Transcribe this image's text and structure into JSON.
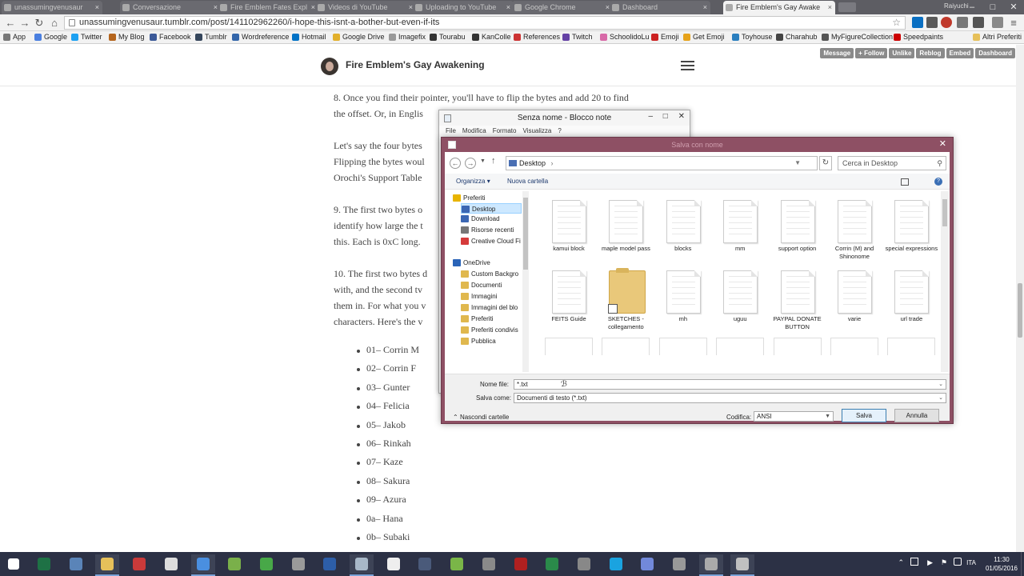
{
  "browser": {
    "tabs": [
      {
        "label": "unassumingvenusaur",
        "active": false
      },
      {
        "label": "Conversazione",
        "active": false
      },
      {
        "label": "Fire Emblem Fates Expl",
        "active": false
      },
      {
        "label": "Videos di YouTube",
        "active": false
      },
      {
        "label": "Uploading to YouTube",
        "active": false
      },
      {
        "label": "Google Chrome",
        "active": false
      },
      {
        "label": "Dashboard",
        "active": false
      },
      {
        "label": "Fire Emblem's Gay Awake",
        "active": true
      }
    ],
    "user_badge": "Raiyuchi",
    "url": "unassumingvenusaur.tumblr.com/post/141102962260/i-hope-this-isnt-a-bother-but-even-if-its",
    "bookmarks": [
      {
        "label": "App",
        "color": "#777777"
      },
      {
        "label": "Google",
        "color": "#4a7fe0"
      },
      {
        "label": "Twitter",
        "color": "#1da1f2"
      },
      {
        "label": "My Blog",
        "color": "#b5651d"
      },
      {
        "label": "Facebook",
        "color": "#3b5998"
      },
      {
        "label": "Tumblr",
        "color": "#35465c"
      },
      {
        "label": "Wordreference",
        "color": "#3366aa"
      },
      {
        "label": "Hotmail",
        "color": "#0072c6"
      },
      {
        "label": "Google Drive",
        "color": "#e2b02c"
      },
      {
        "label": "Imagefix",
        "color": "#999999"
      },
      {
        "label": "Tourabu",
        "color": "#333333"
      },
      {
        "label": "KanColle",
        "color": "#333333"
      },
      {
        "label": "References",
        "color": "#cc3333"
      },
      {
        "label": "Twitch",
        "color": "#6441a5"
      },
      {
        "label": "SchoolidoLu",
        "color": "#d86aa8"
      },
      {
        "label": "Emoji",
        "color": "#cc2222"
      },
      {
        "label": "Get Emoji",
        "color": "#e6a21a"
      },
      {
        "label": "Toyhouse",
        "color": "#2b7fbf"
      },
      {
        "label": "Charahub",
        "color": "#444444"
      },
      {
        "label": "MyFigureCollection",
        "color": "#555555"
      },
      {
        "label": "Speedpaints",
        "color": "#cc0000"
      }
    ],
    "other_bookmarks": "Altri Preferiti"
  },
  "tumblr_controls": [
    "Message",
    "+ Follow",
    "Unlike",
    "Reblog",
    "Embed",
    "Dashboard"
  ],
  "blog": {
    "title": "Fire Emblem's Gay Awakening",
    "paragraphs": [
      [
        "8. Once you find their pointer, you'll have to flip the bytes and add 20 to find",
        "the offset. Or, in Englis"
      ],
      [
        "Let's say the four bytes",
        "Flipping the bytes woul",
        "Orochi's Support Table"
      ],
      [
        "9. The first two bytes o",
        "identify how large the t",
        "this. Each is 0xC long."
      ],
      [
        "10. The first two bytes d",
        "with, and the second tv",
        "them in. For what you v",
        "characters. Here's the v"
      ]
    ],
    "list": [
      "01– Corrin M",
      "02– Corrin F",
      "03– Gunter",
      "04– Felicia",
      "05– Jakob",
      "06– Rinkah",
      "07– Kaze",
      "08– Sakura",
      "09– Azura",
      "0a– Hana",
      "0b– Subaki"
    ]
  },
  "notepad": {
    "title": "Senza nome - Blocco note",
    "menu": [
      "File",
      "Modifica",
      "Formato",
      "Visualizza",
      "?"
    ]
  },
  "save_dialog": {
    "title": "Salva con nome",
    "path": "Desktop",
    "search_placeholder": "Cerca in Desktop",
    "organize": "Organizza",
    "new_folder": "Nuova cartella",
    "nav": [
      {
        "label": "Preferiti",
        "type": "header",
        "color": "#e8b400"
      },
      {
        "label": "Desktop",
        "type": "item",
        "color": "#3b67b3",
        "selected": true
      },
      {
        "label": "Download",
        "type": "item",
        "color": "#3b67b3"
      },
      {
        "label": "Risorse recenti",
        "type": "item",
        "color": "#777777"
      },
      {
        "label": "Creative Cloud Fi",
        "type": "item",
        "color": "#d53b3b"
      },
      {
        "label": "OneDrive",
        "type": "header",
        "color": "#2a64b8"
      },
      {
        "label": "Custom Backgro",
        "type": "item",
        "color": "#e0b84e"
      },
      {
        "label": "Documenti",
        "type": "item",
        "color": "#e0b84e"
      },
      {
        "label": "Immagini",
        "type": "item",
        "color": "#e0b84e"
      },
      {
        "label": "Immagini del blo",
        "type": "item",
        "color": "#e0b84e"
      },
      {
        "label": "Preferiti",
        "type": "item",
        "color": "#e0b84e"
      },
      {
        "label": "Preferiti condivis",
        "type": "item",
        "color": "#e0b84e"
      },
      {
        "label": "Pubblica",
        "type": "item",
        "color": "#e0b84e"
      }
    ],
    "files": [
      {
        "label": "kamui block",
        "kind": "doc"
      },
      {
        "label": "maple model pass",
        "kind": "doc"
      },
      {
        "label": "blocks",
        "kind": "doc"
      },
      {
        "label": "mm",
        "kind": "doc"
      },
      {
        "label": "support option",
        "kind": "doc"
      },
      {
        "label": "Corrin (M) and Shinonome",
        "kind": "doc"
      },
      {
        "label": "special expressions",
        "kind": "doc"
      },
      {
        "label": "FEITS Guide",
        "kind": "doc"
      },
      {
        "label": "SKETCHES - collegamento",
        "kind": "folder"
      },
      {
        "label": "mh",
        "kind": "doc"
      },
      {
        "label": "uguu",
        "kind": "doc"
      },
      {
        "label": "PAYPAL DONATE BUTTON",
        "kind": "doc"
      },
      {
        "label": "varie",
        "kind": "doc"
      },
      {
        "label": "url trade",
        "kind": "doc"
      }
    ],
    "filename_label": "Nome file:",
    "filename_value": "*.txt",
    "saveas_label": "Salva come:",
    "saveas_value": "Documenti di testo (*.txt)",
    "hide_folders": "Nascondi cartelle",
    "encoding_label": "Codifica:",
    "encoding_value": "ANSI",
    "save_button": "Salva",
    "cancel_button": "Annulla"
  },
  "taskbar": {
    "apps": [
      {
        "name": "start",
        "color": "#ffffff"
      },
      {
        "name": "excel",
        "color": "#1e7145"
      },
      {
        "name": "control-panel",
        "color": "#5a84b8"
      },
      {
        "name": "explorer",
        "color": "#e6c05a"
      },
      {
        "name": "acrobat",
        "color": "#c93a3a"
      },
      {
        "name": "media-player",
        "color": "#dddddd"
      },
      {
        "name": "chrome",
        "color": "#4a8fe0"
      },
      {
        "name": "maps",
        "color": "#7ab04a"
      },
      {
        "name": "paint",
        "color": "#48a848"
      },
      {
        "name": "steam-icon-app",
        "color": "#9a9a9a"
      },
      {
        "name": "photoshop",
        "color": "#2d5ea8"
      },
      {
        "name": "notepad",
        "color": "#a8b8c8"
      },
      {
        "name": "sumo",
        "color": "#eeeeee"
      },
      {
        "name": "steam",
        "color": "#4a5a7a"
      },
      {
        "name": "utorrent",
        "color": "#7ab648"
      },
      {
        "name": "fire-emblem",
        "color": "#8a8a8a"
      },
      {
        "name": "fire-emblem-red",
        "color": "#b02020"
      },
      {
        "name": "fire-emblem-green",
        "color": "#2a8a4a"
      },
      {
        "name": "game",
        "color": "#888888"
      },
      {
        "name": "skype",
        "color": "#1aa3e0"
      },
      {
        "name": "discord",
        "color": "#7289da"
      },
      {
        "name": "fire-emblem-2",
        "color": "#999999"
      },
      {
        "name": "fire-emblem-3",
        "color": "#aaaaaa"
      },
      {
        "name": "dialog-window",
        "color": "#c0c0c0"
      }
    ],
    "language": "ITA",
    "time": "11:30",
    "date": "01/05/2016"
  }
}
